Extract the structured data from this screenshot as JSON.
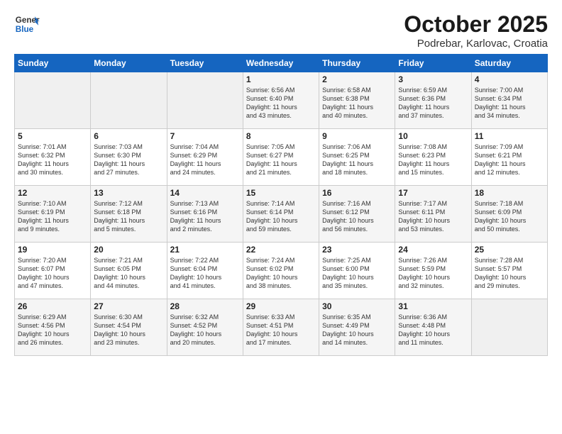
{
  "header": {
    "logo_line1": "General",
    "logo_line2": "Blue",
    "month": "October 2025",
    "location": "Podrebar, Karlovac, Croatia"
  },
  "weekdays": [
    "Sunday",
    "Monday",
    "Tuesday",
    "Wednesday",
    "Thursday",
    "Friday",
    "Saturday"
  ],
  "weeks": [
    [
      {
        "num": "",
        "info": ""
      },
      {
        "num": "",
        "info": ""
      },
      {
        "num": "",
        "info": ""
      },
      {
        "num": "1",
        "info": "Sunrise: 6:56 AM\nSunset: 6:40 PM\nDaylight: 11 hours\nand 43 minutes."
      },
      {
        "num": "2",
        "info": "Sunrise: 6:58 AM\nSunset: 6:38 PM\nDaylight: 11 hours\nand 40 minutes."
      },
      {
        "num": "3",
        "info": "Sunrise: 6:59 AM\nSunset: 6:36 PM\nDaylight: 11 hours\nand 37 minutes."
      },
      {
        "num": "4",
        "info": "Sunrise: 7:00 AM\nSunset: 6:34 PM\nDaylight: 11 hours\nand 34 minutes."
      }
    ],
    [
      {
        "num": "5",
        "info": "Sunrise: 7:01 AM\nSunset: 6:32 PM\nDaylight: 11 hours\nand 30 minutes."
      },
      {
        "num": "6",
        "info": "Sunrise: 7:03 AM\nSunset: 6:30 PM\nDaylight: 11 hours\nand 27 minutes."
      },
      {
        "num": "7",
        "info": "Sunrise: 7:04 AM\nSunset: 6:29 PM\nDaylight: 11 hours\nand 24 minutes."
      },
      {
        "num": "8",
        "info": "Sunrise: 7:05 AM\nSunset: 6:27 PM\nDaylight: 11 hours\nand 21 minutes."
      },
      {
        "num": "9",
        "info": "Sunrise: 7:06 AM\nSunset: 6:25 PM\nDaylight: 11 hours\nand 18 minutes."
      },
      {
        "num": "10",
        "info": "Sunrise: 7:08 AM\nSunset: 6:23 PM\nDaylight: 11 hours\nand 15 minutes."
      },
      {
        "num": "11",
        "info": "Sunrise: 7:09 AM\nSunset: 6:21 PM\nDaylight: 11 hours\nand 12 minutes."
      }
    ],
    [
      {
        "num": "12",
        "info": "Sunrise: 7:10 AM\nSunset: 6:19 PM\nDaylight: 11 hours\nand 9 minutes."
      },
      {
        "num": "13",
        "info": "Sunrise: 7:12 AM\nSunset: 6:18 PM\nDaylight: 11 hours\nand 5 minutes."
      },
      {
        "num": "14",
        "info": "Sunrise: 7:13 AM\nSunset: 6:16 PM\nDaylight: 11 hours\nand 2 minutes."
      },
      {
        "num": "15",
        "info": "Sunrise: 7:14 AM\nSunset: 6:14 PM\nDaylight: 10 hours\nand 59 minutes."
      },
      {
        "num": "16",
        "info": "Sunrise: 7:16 AM\nSunset: 6:12 PM\nDaylight: 10 hours\nand 56 minutes."
      },
      {
        "num": "17",
        "info": "Sunrise: 7:17 AM\nSunset: 6:11 PM\nDaylight: 10 hours\nand 53 minutes."
      },
      {
        "num": "18",
        "info": "Sunrise: 7:18 AM\nSunset: 6:09 PM\nDaylight: 10 hours\nand 50 minutes."
      }
    ],
    [
      {
        "num": "19",
        "info": "Sunrise: 7:20 AM\nSunset: 6:07 PM\nDaylight: 10 hours\nand 47 minutes."
      },
      {
        "num": "20",
        "info": "Sunrise: 7:21 AM\nSunset: 6:05 PM\nDaylight: 10 hours\nand 44 minutes."
      },
      {
        "num": "21",
        "info": "Sunrise: 7:22 AM\nSunset: 6:04 PM\nDaylight: 10 hours\nand 41 minutes."
      },
      {
        "num": "22",
        "info": "Sunrise: 7:24 AM\nSunset: 6:02 PM\nDaylight: 10 hours\nand 38 minutes."
      },
      {
        "num": "23",
        "info": "Sunrise: 7:25 AM\nSunset: 6:00 PM\nDaylight: 10 hours\nand 35 minutes."
      },
      {
        "num": "24",
        "info": "Sunrise: 7:26 AM\nSunset: 5:59 PM\nDaylight: 10 hours\nand 32 minutes."
      },
      {
        "num": "25",
        "info": "Sunrise: 7:28 AM\nSunset: 5:57 PM\nDaylight: 10 hours\nand 29 minutes."
      }
    ],
    [
      {
        "num": "26",
        "info": "Sunrise: 6:29 AM\nSunset: 4:56 PM\nDaylight: 10 hours\nand 26 minutes."
      },
      {
        "num": "27",
        "info": "Sunrise: 6:30 AM\nSunset: 4:54 PM\nDaylight: 10 hours\nand 23 minutes."
      },
      {
        "num": "28",
        "info": "Sunrise: 6:32 AM\nSunset: 4:52 PM\nDaylight: 10 hours\nand 20 minutes."
      },
      {
        "num": "29",
        "info": "Sunrise: 6:33 AM\nSunset: 4:51 PM\nDaylight: 10 hours\nand 17 minutes."
      },
      {
        "num": "30",
        "info": "Sunrise: 6:35 AM\nSunset: 4:49 PM\nDaylight: 10 hours\nand 14 minutes."
      },
      {
        "num": "31",
        "info": "Sunrise: 6:36 AM\nSunset: 4:48 PM\nDaylight: 10 hours\nand 11 minutes."
      },
      {
        "num": "",
        "info": ""
      }
    ]
  ]
}
